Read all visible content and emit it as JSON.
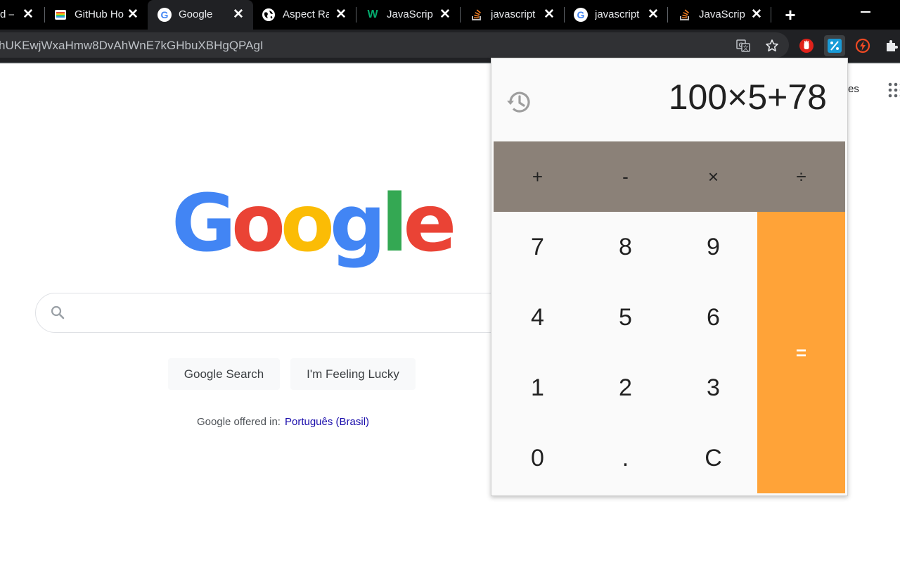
{
  "tabs": [
    {
      "title": "d –",
      "favicon": "partial-tab-icon"
    },
    {
      "title": "GitHub Ho",
      "favicon": "github-rainbow-icon"
    },
    {
      "title": "Google",
      "favicon": "google-g-icon",
      "active": true
    },
    {
      "title": "Aspect Ra",
      "favicon": "globe-icon"
    },
    {
      "title": "JavaScript",
      "favicon": "w3schools-icon"
    },
    {
      "title": "javascript",
      "favicon": "stackoverflow-icon"
    },
    {
      "title": "javascript",
      "favicon": "google-g-icon"
    },
    {
      "title": "JavaScript",
      "favicon": "stackoverflow-icon"
    }
  ],
  "address_bar": {
    "url": "hUKEwjWxaHmw8DvAhWnE7kGHbuXBHgQPAgI"
  },
  "google": {
    "logo": [
      "G",
      "o",
      "o",
      "g",
      "l",
      "e"
    ],
    "logo_colors": [
      "#4285F4",
      "#EA4335",
      "#FBBC05",
      "#4285F4",
      "#34A853",
      "#EA4335"
    ],
    "search_button": "Google Search",
    "lucky_button": "I'm Feeling Lucky",
    "offered_in_label": "Google offered in:",
    "offered_in_language": "Português (Brasil)",
    "header_partial_text": "es"
  },
  "calculator": {
    "expression": "100×5+78",
    "operators": [
      "+",
      "-",
      "×",
      "÷"
    ],
    "keys": [
      [
        "7",
        "8",
        "9"
      ],
      [
        "4",
        "5",
        "6"
      ],
      [
        "1",
        "2",
        "3"
      ],
      [
        "0",
        ".",
        "C"
      ]
    ],
    "equals": "=",
    "colors": {
      "operator_row": "#8b8178",
      "equals": "#ffa338",
      "display_bg": "#fafafa"
    }
  }
}
